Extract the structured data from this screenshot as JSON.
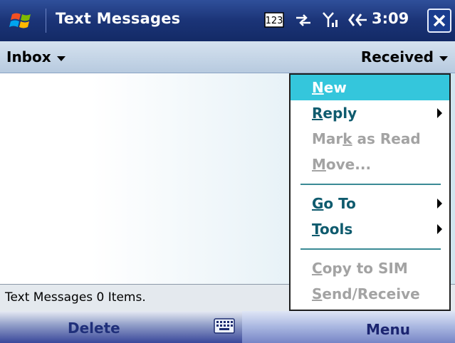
{
  "titlebar": {
    "title": "Text Messages",
    "clock": "3:09",
    "start_icon": "windows-flag-icon",
    "input_icon": "input-mode-123-icon",
    "network_icon": "network-arrows-icon",
    "signal_icon": "signal-strength-icon",
    "volume_icon": "speaker-icon",
    "close_icon": "close-x-icon"
  },
  "header": {
    "folder_label": "Inbox",
    "sort_label": "Received"
  },
  "status": {
    "text": "Text Messages  0 Items."
  },
  "softkeys": {
    "left": "Delete",
    "right": "Menu",
    "keyboard_icon": "keyboard-icon"
  },
  "menu": {
    "items": [
      {
        "pre": "",
        "u": "N",
        "post": "ew",
        "state": "highlighted"
      },
      {
        "pre": "",
        "u": "R",
        "post": "eply",
        "state": "enabled",
        "submenu": true
      },
      {
        "pre": "Mar",
        "u": "k",
        "post": " as Read",
        "state": "disabled"
      },
      {
        "pre": "",
        "u": "M",
        "post": "ove...",
        "state": "disabled"
      },
      {
        "pre": "",
        "u": "G",
        "post": "o To",
        "state": "enabled",
        "submenu": true
      },
      {
        "pre": "",
        "u": "T",
        "post": "ools",
        "state": "enabled",
        "submenu": true
      },
      {
        "pre": "",
        "u": "C",
        "post": "opy to SIM",
        "state": "disabled"
      },
      {
        "pre": "",
        "u": "S",
        "post": "end/Receive",
        "state": "disabled"
      }
    ]
  },
  "colors": {
    "titlebar": "#1b3477",
    "menu_highlight": "#34c6dc",
    "menu_text": "#0f5b6e",
    "menu_disabled": "#a3a3a3"
  }
}
